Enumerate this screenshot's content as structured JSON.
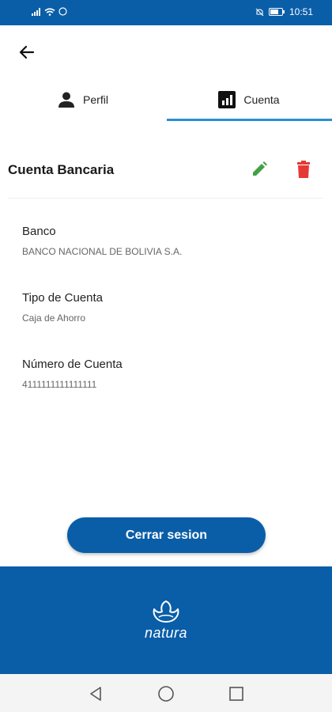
{
  "status_bar": {
    "time": "10:51"
  },
  "tabs": [
    {
      "label": "Perfil",
      "icon": "person-icon"
    },
    {
      "label": "Cuenta",
      "icon": "bar-chart-icon"
    }
  ],
  "section": {
    "title": "Cuenta Bancaria"
  },
  "fields": [
    {
      "label": "Banco",
      "value": "BANCO NACIONAL DE BOLIVIA S.A."
    },
    {
      "label": "Tipo de Cuenta",
      "value": "Caja de Ahorro"
    },
    {
      "label": "Número de Cuenta",
      "value": "4111111111111111"
    }
  ],
  "logout_label": "Cerrar sesion",
  "brand": {
    "name": "natura"
  },
  "colors": {
    "primary": "#0a5ea8",
    "accent": "#2a8fd0",
    "edit": "#43a047",
    "delete": "#e53935"
  }
}
